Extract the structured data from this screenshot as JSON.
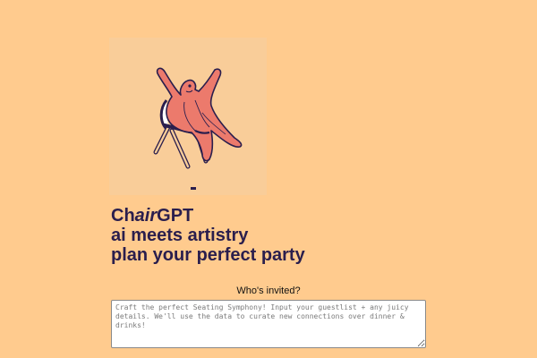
{
  "hero": {
    "illustration": "person-leaping-from-folding-chair",
    "colors": {
      "background": "#f9cd99",
      "figure": "#ec7a6c",
      "outline": "#2a1e4d"
    }
  },
  "headline": {
    "brand_prefix": "Ch",
    "brand_italic": "air",
    "brand_suffix": "GPT",
    "tagline_1": "ai meets artistry",
    "tagline_2": "plan your perfect party"
  },
  "guests": {
    "label": "Who's invited?",
    "placeholder": "Craft the perfect Seating Symphony! Input your guestlist + any juicy details. We'll use the data to curate new connections over dinner & drinks!",
    "value": ""
  },
  "theme": {
    "page_background": "#ffcb8e",
    "headline_color": "#2a1e4d"
  }
}
